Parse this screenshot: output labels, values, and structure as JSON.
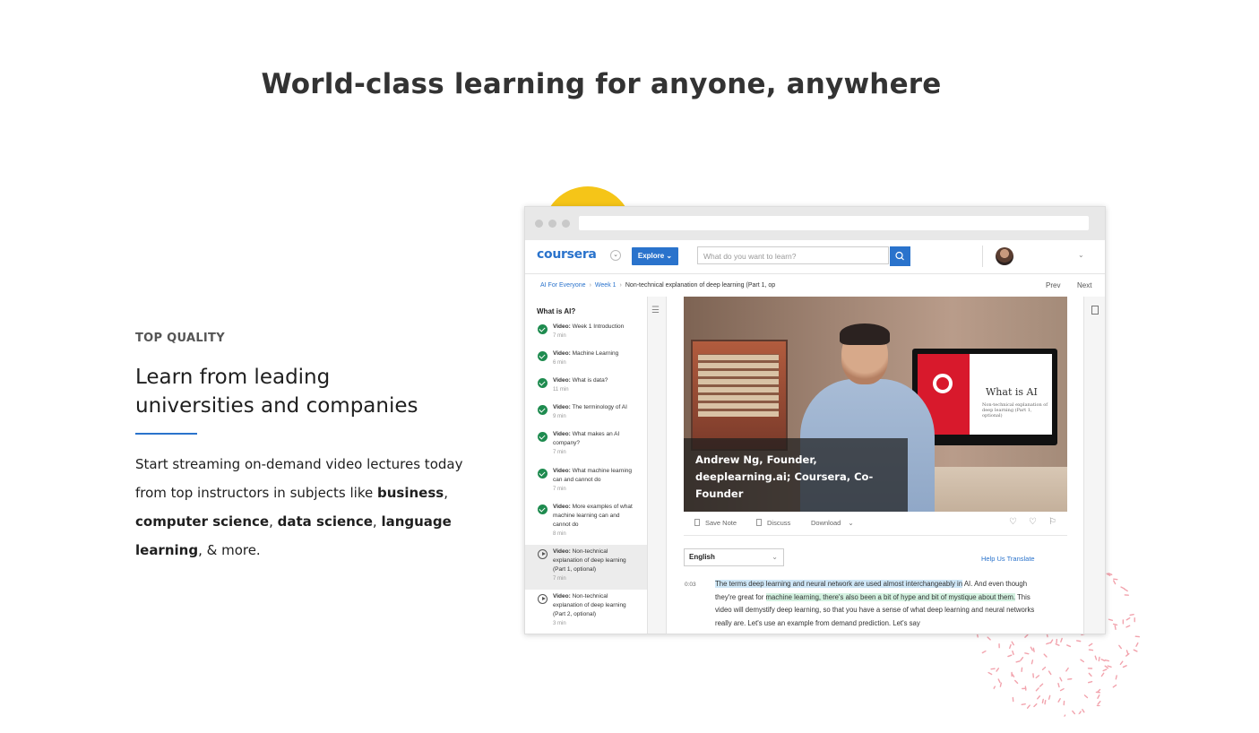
{
  "page_title": "World-class learning for anyone, anywhere",
  "feature": {
    "eyebrow": "TOP QUALITY",
    "heading": "Learn from leading universities and companies",
    "body_intro": "Start streaming on-demand video lectures today from top instructors in subjects like ",
    "subject_1": "business",
    "subject_2": "computer science",
    "subject_3": "data science",
    "subject_4": "language learning",
    "sep_comma": ", ",
    "body_outro": ", & more.",
    "accent_color": "#2a73cc"
  },
  "app": {
    "logo": "coursera",
    "explore_label": "Explore ⌄",
    "search_placeholder": "What do you want to learn?",
    "breadcrumb": [
      "AI For Everyone",
      "Week 1",
      "Non-technical explanation of deep learning (Part 1, op"
    ],
    "crumb_sep": "›",
    "prev_label": "Prev",
    "next_label": "Next",
    "sidebar": {
      "title": "What is AI?",
      "video_prefix": "Video:",
      "items": [
        {
          "title": "Week 1 Introduction",
          "duration": "7 min",
          "status": "done"
        },
        {
          "title": "Machine Learning",
          "duration": "6 min",
          "status": "done"
        },
        {
          "title": "What is data?",
          "duration": "11 min",
          "status": "done"
        },
        {
          "title": "The terminology of AI",
          "duration": "9 min",
          "status": "done"
        },
        {
          "title": "What makes an AI company?",
          "duration": "7 min",
          "status": "done"
        },
        {
          "title": "What machine learning can and cannot do",
          "duration": "7 min",
          "status": "done"
        },
        {
          "title": "More examples of what machine learning can and cannot do",
          "duration": "8 min",
          "status": "done"
        },
        {
          "title": "Non-technical explanation of deep learning (Part 1, optional)",
          "duration": "7 min",
          "status": "current"
        },
        {
          "title": "Non-technical explanation of deep learning (Part 2, optional)",
          "duration": "3 min",
          "status": "todo"
        }
      ]
    },
    "video": {
      "caption": "Andrew Ng, Founder, deeplearning.ai; Coursera, Co-Founder",
      "screen_title": "What is AI",
      "screen_subtitle": "Non-technical explanation of deep learning (Part 1, optional)"
    },
    "toolbar": {
      "save_note": "Save Note",
      "discuss": "Discuss",
      "download": "Download"
    },
    "transcript": {
      "language": "English",
      "help_translate": "Help Us Translate",
      "timestamp": "0:03",
      "hl1": "The terms deep learning and neural network are used almost interchangeably in",
      "t1": " AI. And even though they're great for ",
      "hl2": "machine learning, there's also been a bit of hype and bit of mystique about them.",
      "t2": " This video will demystify deep learning, so that you have a sense of what deep learning and neural networks really are. Let's use an example from demand prediction. Let's say"
    }
  }
}
